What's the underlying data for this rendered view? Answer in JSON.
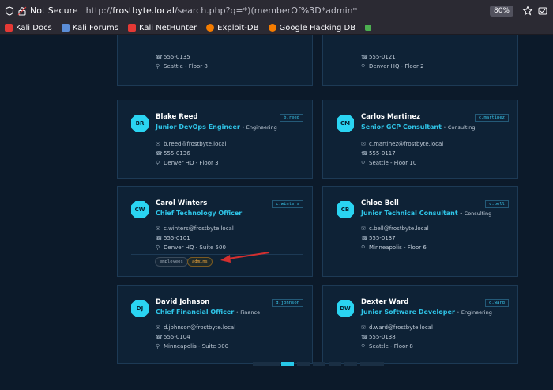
{
  "browser": {
    "not_secure_label": "Not Secure",
    "url_prefix": "http://",
    "url_host": "frostbyte.local",
    "url_path": "/search.php?q=*)(memberOf%3D*admin*",
    "zoom": "80%"
  },
  "bookmarks": [
    {
      "label": "Kali Docs",
      "color": "#e53935"
    },
    {
      "label": "Kali Forums",
      "color": "#5b8dd6"
    },
    {
      "label": "Kali NetHunter",
      "color": "#e53935"
    },
    {
      "label": "Exploit-DB",
      "color": "#f57c00"
    },
    {
      "label": "Google Hacking DB",
      "color": "#f57c00"
    }
  ],
  "partial_cards": [
    {
      "phone": "555-0135",
      "location": "Seattle - Floor 8"
    },
    {
      "phone": "555-0121",
      "location": "Denver HQ - Floor 2"
    }
  ],
  "cards": [
    {
      "initials": "BR",
      "name": "Blake Reed",
      "title": "Junior DevOps Engineer",
      "dept": "Engineering",
      "uid": "b.reed",
      "email": "b.reed@frostbyte.local",
      "phone": "555-0136",
      "location": "Denver HQ - Floor 3"
    },
    {
      "initials": "CM",
      "name": "Carlos Martinez",
      "title": "Senior GCP Consultant",
      "dept": "Consulting",
      "uid": "c.martinez",
      "email": "c.martinez@frostbyte.local",
      "phone": "555-0117",
      "location": "Seattle - Floor 10"
    },
    {
      "initials": "CW",
      "name": "Carol Winters",
      "title": "Chief Technology Officer",
      "dept": "",
      "uid": "c.winters",
      "email": "c.winters@frostbyte.local",
      "phone": "555-0101",
      "location": "Denver HQ - Suite 500",
      "tags": [
        "employees",
        "admins"
      ]
    },
    {
      "initials": "CB",
      "name": "Chloe Bell",
      "title": "Junior Technical Consultant",
      "dept": "Consulting",
      "uid": "c.bell",
      "email": "c.bell@frostbyte.local",
      "phone": "555-0137",
      "location": "Minneapolis - Floor 6"
    },
    {
      "initials": "DJ",
      "name": "David Johnson",
      "title": "Chief Financial Officer",
      "dept": "Finance",
      "uid": "d.johnson",
      "email": "d.johnson@frostbyte.local",
      "phone": "555-0104",
      "location": "Minneapolis - Suite 300"
    },
    {
      "initials": "DW",
      "name": "Dexter Ward",
      "title": "Junior Software Developer",
      "dept": "Engineering",
      "uid": "d.ward",
      "email": "d.ward@frostbyte.local",
      "phone": "555-0138",
      "location": "Seattle - Floor 8"
    }
  ],
  "dept_separator": " • ",
  "icons": {
    "email": "✉",
    "phone": "☎",
    "location": "⚲"
  },
  "colors": {
    "accent": "#2ad4f2",
    "admin_tag": "#f2a63a",
    "annotation_arrow": "#d32f2f"
  }
}
